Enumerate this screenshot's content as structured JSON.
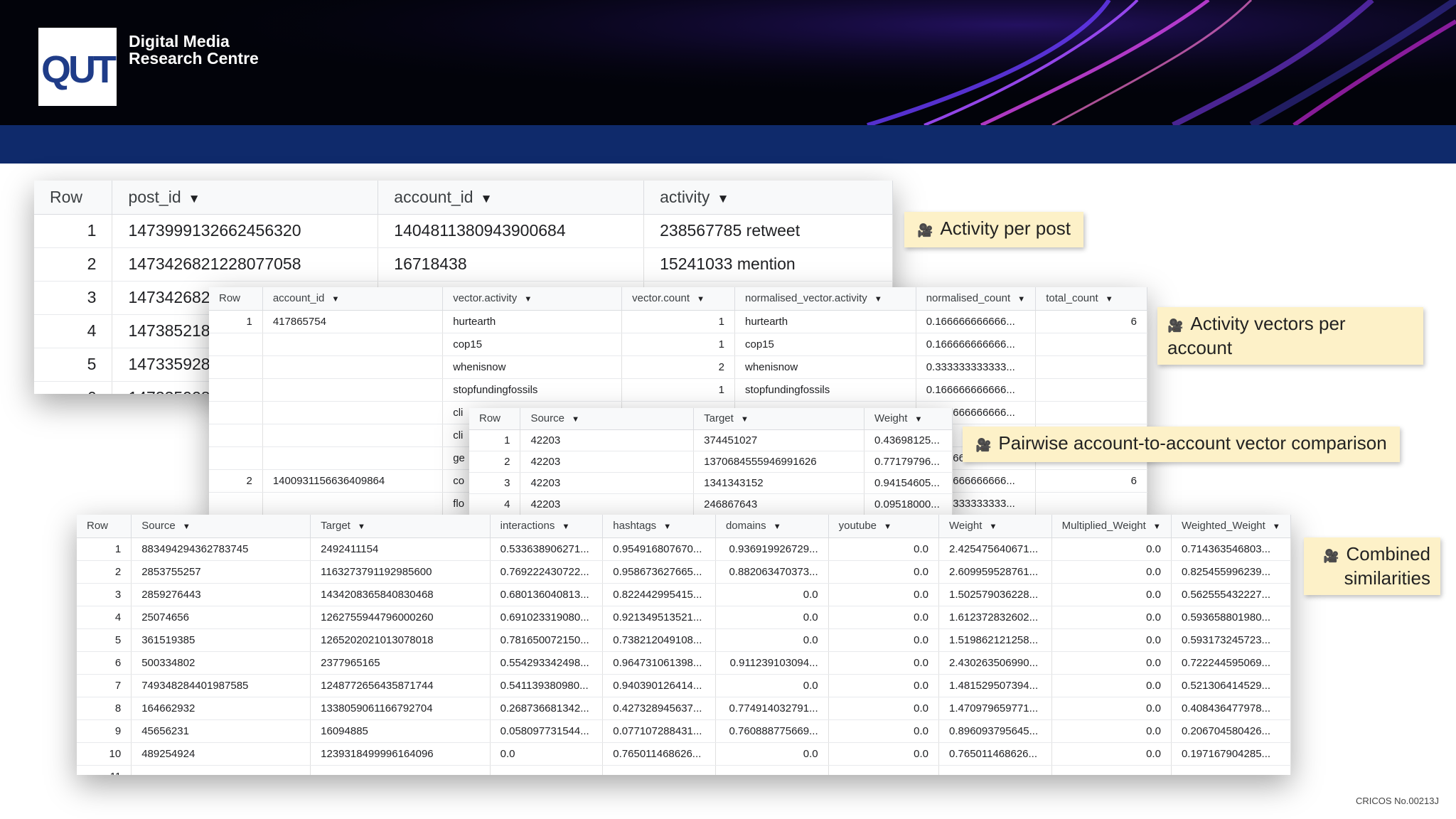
{
  "branding": {
    "logo": "QUT",
    "centre_line1": "Digital Media",
    "centre_line2": "Research Centre"
  },
  "footer": {
    "cricos": "CRICOS No.00213J"
  },
  "labels": {
    "activity_per_post": "Activity per post",
    "vectors_per_account": "Activity vectors per account",
    "pairwise": "Pairwise account-to-account vector comparison",
    "combined": "Combined similarities"
  },
  "table1": {
    "headers": [
      "Row",
      "post_id",
      "account_id",
      "activity"
    ],
    "rows": [
      [
        "1",
        "1473999132662456320",
        "1404811380943900684",
        "238567785 retweet"
      ],
      [
        "2",
        "1473426821228077058",
        "16718438",
        "15241033 mention"
      ],
      [
        "3",
        "147342682",
        "",
        ""
      ],
      [
        "4",
        "147385218",
        "",
        ""
      ],
      [
        "5",
        "147335928",
        "",
        ""
      ],
      [
        "6",
        "147335928",
        "",
        ""
      ]
    ]
  },
  "table2": {
    "headers": [
      "Row",
      "account_id",
      "vector.activity",
      "vector.count",
      "normalised_vector.activity",
      "normalised_count",
      "total_count"
    ],
    "rows": [
      [
        "1",
        "417865754",
        "hurtearth",
        "1",
        "hurtearth",
        "0.166666666666...",
        "6"
      ],
      [
        "",
        "",
        "cop15",
        "1",
        "cop15",
        "0.166666666666...",
        ""
      ],
      [
        "",
        "",
        "whenisnow",
        "2",
        "whenisnow",
        "0.333333333333...",
        ""
      ],
      [
        "",
        "",
        "stopfundingfossils",
        "1",
        "stopfundingfossils",
        "0.166666666666...",
        ""
      ],
      [
        "",
        "",
        "cli",
        "",
        "",
        "0.166666666666...",
        ""
      ],
      [
        "",
        "",
        "cli",
        "",
        "",
        "",
        ""
      ],
      [
        "",
        "",
        "ge",
        "",
        "",
        "0.166666666666...",
        ""
      ],
      [
        "2",
        "1400931156636409864",
        "co",
        "",
        "",
        "0.166666666666...",
        "6"
      ],
      [
        "",
        "",
        "flo",
        "",
        "",
        "0.333333333333...",
        ""
      ]
    ]
  },
  "table3": {
    "headers": [
      "Row",
      "Source",
      "Target",
      "Weight"
    ],
    "rows": [
      [
        "1",
        "42203",
        "374451027",
        "0.43698125..."
      ],
      [
        "2",
        "42203",
        "1370684555946991626",
        "0.77179796..."
      ],
      [
        "3",
        "42203",
        "1341343152",
        "0.94154605..."
      ],
      [
        "4",
        "42203",
        "246867643",
        "0.09518000..."
      ]
    ]
  },
  "table4": {
    "headers": [
      "Row",
      "Source",
      "Target",
      "interactions",
      "hashtags",
      "domains",
      "youtube",
      "Weight",
      "Multiplied_Weight",
      "Weighted_Weight"
    ],
    "rows": [
      [
        "1",
        "883494294362783745",
        "2492411154",
        "0.533638906271...",
        "0.954916807670...",
        "0.936919926729...",
        "0.0",
        "2.425475640671...",
        "0.0",
        "0.714363546803..."
      ],
      [
        "2",
        "2853755257",
        "1163273791192985600",
        "0.769222430722...",
        "0.958673627665...",
        "0.882063470373...",
        "0.0",
        "2.609959528761...",
        "0.0",
        "0.825455996239..."
      ],
      [
        "3",
        "2859276443",
        "1434208365840830468",
        "0.680136040813...",
        "0.822442995415...",
        "0.0",
        "0.0",
        "1.502579036228...",
        "0.0",
        "0.562555432227..."
      ],
      [
        "4",
        "25074656",
        "1262755944796000260",
        "0.691023319080...",
        "0.921349513521...",
        "0.0",
        "0.0",
        "1.612372832602...",
        "0.0",
        "0.593658801980..."
      ],
      [
        "5",
        "361519385",
        "1265202021013078018",
        "0.781650072150...",
        "0.738212049108...",
        "0.0",
        "0.0",
        "1.519862121258...",
        "0.0",
        "0.593173245723..."
      ],
      [
        "6",
        "500334802",
        "2377965165",
        "0.554293342498...",
        "0.964731061398...",
        "0.911239103094...",
        "0.0",
        "2.430263506990...",
        "0.0",
        "0.722244595069..."
      ],
      [
        "7",
        "749348284401987585",
        "1248772656435871744",
        "0.541139380980...",
        "0.940390126414...",
        "0.0",
        "0.0",
        "1.481529507394...",
        "0.0",
        "0.521306414529..."
      ],
      [
        "8",
        "164662932",
        "1338059061166792704",
        "0.268736681342...",
        "0.427328945637...",
        "0.774914032791...",
        "0.0",
        "1.470979659771...",
        "0.0",
        "0.408436477978..."
      ],
      [
        "9",
        "45656231",
        "16094885",
        "0.058097731544...",
        "0.077107288431...",
        "0.760888775669...",
        "0.0",
        "0.896093795645...",
        "0.0",
        "0.206704580426..."
      ],
      [
        "10",
        "489254924",
        "1239318499996164096",
        "0.0",
        "0.765011468626...",
        "0.0",
        "0.0",
        "0.765011468626...",
        "0.0",
        "0.197167904285..."
      ],
      [
        "11",
        "",
        "",
        "",
        "",
        "",
        "",
        "",
        "",
        ""
      ]
    ]
  }
}
